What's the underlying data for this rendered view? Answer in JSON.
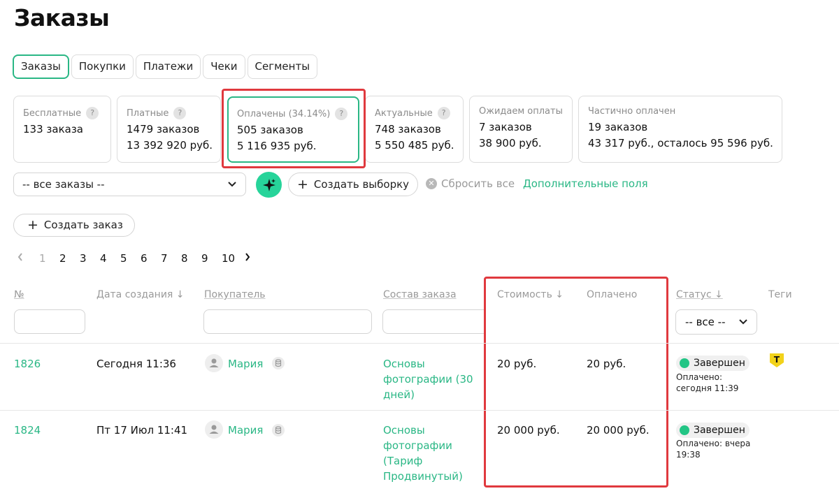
{
  "page": {
    "title": "Заказы"
  },
  "tabs": [
    {
      "label": "Заказы",
      "active": true
    },
    {
      "label": "Покупки"
    },
    {
      "label": "Платежи"
    },
    {
      "label": "Чеки"
    },
    {
      "label": "Сегменты"
    }
  ],
  "stats": [
    {
      "label": "Бесплатные",
      "help": "?",
      "lines": [
        "133 заказа"
      ]
    },
    {
      "label": "Платные",
      "help": "?",
      "lines": [
        "1479 заказов",
        "13 392 920 руб."
      ]
    },
    {
      "label": "Оплачены (34.14%)",
      "help": "?",
      "lines": [
        "505 заказов",
        "5 116 935 руб."
      ],
      "active": true
    },
    {
      "label": "Актуальные",
      "help": "?",
      "lines": [
        "748 заказов",
        "5 550 485 руб."
      ]
    },
    {
      "label": "Ожидаем оплаты",
      "lines": [
        "7 заказов",
        "38 900 руб."
      ]
    },
    {
      "label": "Частично оплачен",
      "lines": [
        "19 заказов",
        "43 317 руб., осталось 95 596 руб."
      ]
    }
  ],
  "filters": {
    "order_filter": "-- все заказы --",
    "create_selection": "Создать выборку",
    "reset_all": "Сбросить все",
    "extra_fields": "Дополнительные поля"
  },
  "create_order": "Создать заказ",
  "pagination": [
    "1",
    "2",
    "3",
    "4",
    "5",
    "6",
    "7",
    "8",
    "9",
    "10"
  ],
  "table": {
    "columns": {
      "num": "№",
      "created": "Дата создания ↓",
      "buyer": "Покупатель",
      "contents": "Состав заказа",
      "cost": "Стоимость ↓",
      "paid": "Оплачено",
      "status": "Статус ↓",
      "tags": "Теги"
    },
    "status_filter": "-- все --",
    "rows": [
      {
        "num": "1826",
        "created": "Сегодня 11:36",
        "buyer": "Мария",
        "contents": [
          "Основы",
          "фотографии (30",
          "дней)"
        ],
        "cost": "20 руб.",
        "paid": "20 руб.",
        "status": "Завершен",
        "paid_note": [
          "Оплачено:",
          "сегодня 11:39"
        ],
        "tag": "T"
      },
      {
        "num": "1824",
        "created": "Пт 17 Июл 11:41",
        "buyer": "Мария",
        "contents": [
          "Основы",
          "фотографии",
          "(Тариф",
          "Продвинутый)"
        ],
        "cost": "20 000 руб.",
        "paid": "20 000 руб.",
        "status": "Завершен",
        "paid_note": [
          "Оплачено: вчера",
          "19:38"
        ]
      }
    ]
  },
  "colors": {
    "accent": "#2ab785",
    "highlight": "#e0393e",
    "status_dot": "#22c585"
  }
}
